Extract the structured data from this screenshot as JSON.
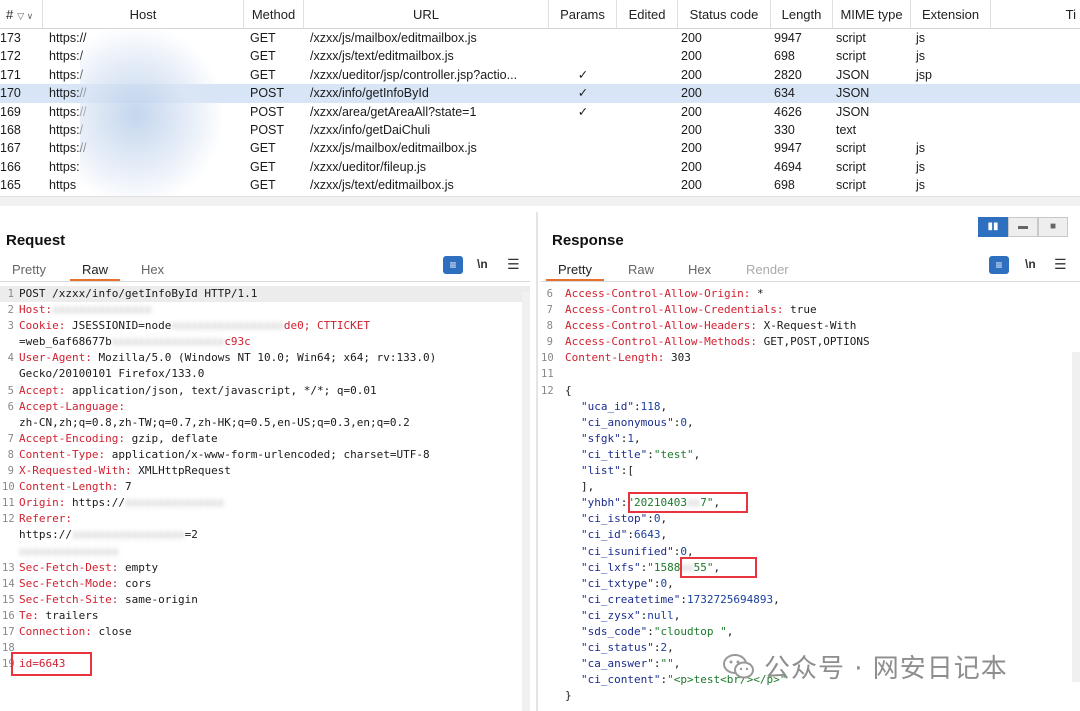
{
  "history": {
    "columns": [
      "#",
      "Host",
      "Method",
      "URL",
      "Params",
      "Edited",
      "Status code",
      "Length",
      "MIME type",
      "Extension",
      "Ti"
    ],
    "rows": [
      {
        "num": "173",
        "host": "https://",
        "method": "GET",
        "url": "/xzxx/js/mailbox/editmailbox.js",
        "params": "",
        "status": "200",
        "length": "9947",
        "mime": "script",
        "ext": "js",
        "selected": false
      },
      {
        "num": "172",
        "host": "https:/",
        "method": "GET",
        "url": "/xzxx/js/text/editmailbox.js",
        "params": "",
        "status": "200",
        "length": "698",
        "mime": "script",
        "ext": "js",
        "selected": false
      },
      {
        "num": "171",
        "host": "https:/",
        "method": "GET",
        "url": "/xzxx/ueditor/jsp/controller.jsp?actio...",
        "params": "✓",
        "status": "200",
        "length": "2820",
        "mime": "JSON",
        "ext": "jsp",
        "selected": false
      },
      {
        "num": "170",
        "host": "https://",
        "method": "POST",
        "url": "/xzxx/info/getInfoById",
        "params": "✓",
        "status": "200",
        "length": "634",
        "mime": "JSON",
        "ext": "",
        "selected": true
      },
      {
        "num": "169",
        "host": "https://",
        "method": "POST",
        "url": "/xzxx/area/getAreaAll?state=1",
        "params": "✓",
        "status": "200",
        "length": "4626",
        "mime": "JSON",
        "ext": "",
        "selected": false
      },
      {
        "num": "168",
        "host": "https:/",
        "method": "POST",
        "url": "/xzxx/info/getDaiChuli",
        "params": "",
        "status": "200",
        "length": "330",
        "mime": "text",
        "ext": "",
        "selected": false
      },
      {
        "num": "167",
        "host": "https://",
        "method": "GET",
        "url": "/xzxx/js/mailbox/editmailbox.js",
        "params": "",
        "status": "200",
        "length": "9947",
        "mime": "script",
        "ext": "js",
        "selected": false
      },
      {
        "num": "166",
        "host": "https:",
        "method": "GET",
        "url": "/xzxx/ueditor/fileup.js",
        "params": "",
        "status": "200",
        "length": "4694",
        "mime": "script",
        "ext": "js",
        "selected": false
      },
      {
        "num": "165",
        "host": "https",
        "method": "GET",
        "url": "/xzxx/js/text/editmailbox.js",
        "params": "",
        "status": "200",
        "length": "698",
        "mime": "script",
        "ext": "js",
        "selected": false
      }
    ]
  },
  "request": {
    "title": "Request",
    "tabs": [
      "Pretty",
      "Raw",
      "Hex"
    ],
    "active_tab": "Raw",
    "lines": [
      {
        "n": "1",
        "key": "",
        "val": "POST /xzxx/info/getInfoById HTTP/1.1"
      },
      {
        "n": "2",
        "key": "Host:",
        "val": ""
      },
      {
        "n": "3",
        "key": "Cookie:",
        "val": " JSESSIONID=node",
        "tail": "de0; CTTICKET"
      },
      {
        "n": "",
        "key": "",
        "val": "=web_6af68677b",
        "tail": "c93c"
      },
      {
        "n": "4",
        "key": "User-Agent:",
        "val": " Mozilla/5.0 (Windows NT 10.0; Win64; x64; rv:133.0)"
      },
      {
        "n": "",
        "key": "",
        "val": "Gecko/20100101 Firefox/133.0"
      },
      {
        "n": "5",
        "key": "Accept:",
        "val": " application/json, text/javascript, */*; q=0.01"
      },
      {
        "n": "6",
        "key": "Accept-Language:",
        "val": ""
      },
      {
        "n": "",
        "key": "",
        "val": "zh-CN,zh;q=0.8,zh-TW;q=0.7,zh-HK;q=0.5,en-US;q=0.3,en;q=0.2"
      },
      {
        "n": "7",
        "key": "Accept-Encoding:",
        "val": " gzip, deflate"
      },
      {
        "n": "8",
        "key": "Content-Type:",
        "val": " application/x-www-form-urlencoded; charset=UTF-8"
      },
      {
        "n": "9",
        "key": "X-Requested-With:",
        "val": " XMLHttpRequest"
      },
      {
        "n": "10",
        "key": "Content-Length:",
        "val": " 7"
      },
      {
        "n": "11",
        "key": "Origin:",
        "val": " https://"
      },
      {
        "n": "12",
        "key": "Referer:",
        "val": ""
      },
      {
        "n": "",
        "key": "",
        "val": "https://",
        "tail": "=2"
      },
      {
        "n": "",
        "key": "",
        "val": ""
      },
      {
        "n": "13",
        "key": "Sec-Fetch-Dest:",
        "val": " empty"
      },
      {
        "n": "14",
        "key": "Sec-Fetch-Mode:",
        "val": " cors"
      },
      {
        "n": "15",
        "key": "Sec-Fetch-Site:",
        "val": " same-origin"
      },
      {
        "n": "16",
        "key": "Te:",
        "val": " trailers"
      },
      {
        "n": "17",
        "key": "Connection:",
        "val": " close"
      },
      {
        "n": "18",
        "key": "",
        "val": ""
      },
      {
        "n": "19",
        "key": "id",
        "val": "=6643"
      }
    ]
  },
  "response": {
    "title": "Response",
    "tabs": [
      "Pretty",
      "Raw",
      "Hex",
      "Render"
    ],
    "active_tab": "Pretty",
    "header_lines": [
      {
        "n": "6",
        "key": "Access-Control-Allow-Origin:",
        "val": " *"
      },
      {
        "n": "7",
        "key": "Access-Control-Allow-Credentials:",
        "val": " true"
      },
      {
        "n": "8",
        "key": "Access-Control-Allow-Headers:",
        "val": " X-Request-With"
      },
      {
        "n": "9",
        "key": "Access-Control-Allow-Methods:",
        "val": " GET,POST,OPTIONS"
      },
      {
        "n": "10",
        "key": "Content-Length:",
        "val": " 303"
      },
      {
        "n": "11",
        "key": "",
        "val": ""
      },
      {
        "n": "12",
        "key": "",
        "val": "{"
      }
    ],
    "json_lines": [
      {
        "key": "\"uca_id\"",
        "val": "118",
        "type": "num"
      },
      {
        "key": "\"ci_anonymous\"",
        "val": "0",
        "type": "num"
      },
      {
        "key": "\"sfgk\"",
        "val": "1",
        "type": "num"
      },
      {
        "key": "\"ci_title\"",
        "val": "\"test\"",
        "type": "str"
      },
      {
        "key": "\"list\"",
        "val": "[",
        "type": "raw"
      },
      {
        "key": "",
        "val": "],",
        "type": "raw"
      },
      {
        "key": "\"yhbh\"",
        "val": "\"20210403",
        "tail": "7\"",
        "type": "str"
      },
      {
        "key": "\"ci_istop\"",
        "val": "0",
        "type": "num"
      },
      {
        "key": "\"ci_id\"",
        "val": "6643",
        "type": "num"
      },
      {
        "key": "\"ci_isunified\"",
        "val": "0",
        "type": "num"
      },
      {
        "key": "\"ci_lxfs\"",
        "val": "\"1588",
        "tail": "55\"",
        "type": "str"
      },
      {
        "key": "\"ci_txtype\"",
        "val": "0",
        "type": "num"
      },
      {
        "key": "\"ci_createtime\"",
        "val": "1732725694893",
        "type": "num"
      },
      {
        "key": "\"ci_zysx\"",
        "val": "null",
        "type": "num"
      },
      {
        "key": "\"sds_code\"",
        "val": "\"cloudtop    \"",
        "type": "str"
      },
      {
        "key": "\"ci_status\"",
        "val": "2",
        "type": "num"
      },
      {
        "key": "\"ca_answer\"",
        "val": "\"\"",
        "type": "str"
      },
      {
        "key": "\"ci_content\"",
        "val": "\"<p>test<br/></p>\"",
        "type": "str"
      },
      {
        "key": "",
        "val": "}",
        "type": "close"
      }
    ]
  },
  "watermark": "公众号 · 网安日记本",
  "icons": [
    "wrap-lines-icon",
    "newline-icon",
    "menu-icon",
    "layout-split-icon",
    "layout-horizontal-icon",
    "layout-single-icon"
  ]
}
